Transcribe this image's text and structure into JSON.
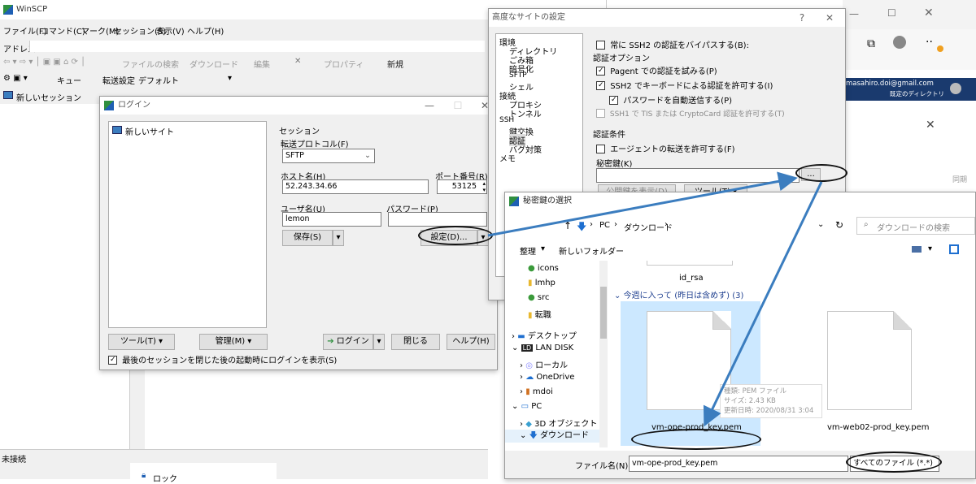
{
  "winscp": {
    "title": "WinSCP",
    "menu": [
      "ファイル(F)",
      "コマンド(C)",
      "マーク(M)",
      "セッション(S)",
      "表示(V)",
      "ヘルプ(H)"
    ],
    "address_label": "アドレス",
    "toolbar_items": [
      "ファイルの検索",
      "ダウンロード",
      "編集",
      "プロパティ",
      "新規"
    ],
    "queue_label": "キュー",
    "transfer_label": "転送設定",
    "transfer_value": "デフォルト",
    "new_session": "新しいセッション",
    "status": "未接続",
    "lock_label": "ロック"
  },
  "login": {
    "title": "ログイン",
    "tree_item": "新しいサイト",
    "session_group": "セッション",
    "protocol_label": "転送プロトコル(F)",
    "protocol_value": "SFTP",
    "host_label": "ホスト名(H)",
    "host_value": "52.243.34.66",
    "port_label": "ポート番号(R)",
    "port_value": "53125",
    "user_label": "ユーザ名(U)",
    "user_value": "lemon",
    "password_label": "パスワード(P)",
    "password_value": "",
    "save_button": "保存(S)",
    "settings_button": "設定(D)...",
    "tools_button": "ツール(T)",
    "manage_button": "管理(M)",
    "login_button": "ログイン",
    "close_button": "閉じる",
    "help_button": "ヘルプ(H)",
    "show_login_check": "最後のセッションを閉じた後の起動時にログインを表示(S)"
  },
  "advanced": {
    "title": "高度なサイトの設定",
    "tree": [
      "環境",
      "ディレクトリ",
      "ごみ箱",
      "暗号化",
      "SFTP",
      "シェル",
      "接続",
      "プロキシ",
      "トンネル",
      "SSH",
      "鍵交換",
      "認証",
      "バグ対策",
      "メモ"
    ],
    "bypass_check": "常に SSH2 の認証をバイパスする(B):",
    "auth_options": "認証オプション",
    "pageant_check": "Pagent での認証を試みる(P)",
    "keyboard_check": "SSH2 でキーボードによる認証を許可する(I)",
    "auto_password_check": "パスワードを自動送信する(P)",
    "tis_check": "SSH1 で TIS または CryptoCard 認証を許可する(T)",
    "auth_params": "認証条件",
    "agent_forward_check": "エージェントの転送を許可する(F)",
    "private_key_label": "秘密鍵(K)",
    "browse_button": "...",
    "show_public_key": "公開鍵を表示(D)",
    "tools_button": "ツール(T)"
  },
  "browser": {
    "account_email": "masahiro.doi@gmail.com",
    "account_dir": "既定のディレクトリ",
    "side_label": "同期"
  },
  "filedialog": {
    "title": "秘密鍵の選択",
    "breadcrumb": [
      "PC",
      "ダウンロード"
    ],
    "search_placeholder": "ダウンロードの検索",
    "organize": "整理",
    "new_folder": "新しいフォルダー",
    "nav": [
      "icons",
      "lmhp",
      "src",
      "転職",
      "デスクトップ",
      "LAN DISK",
      "ローカル",
      "OneDrive",
      "mdoi",
      "PC",
      "3D オブジェクト",
      "ダウンロード"
    ],
    "top_file": "id_rsa",
    "group_header": "今週に入って (昨日は含めず) (3)",
    "files": [
      "vm-ope-prod_key.pem",
      "vm-web02-prod_key.pem"
    ],
    "tooltip": [
      "種類: PEM ファイル",
      "サイズ: 2.43 KB",
      "更新日時: 2020/08/31 3:04"
    ],
    "filename_label": "ファイル名(N):",
    "filename_value": "vm-ope-prod_key.pem",
    "filetype_value": "すべてのファイル (*.*)"
  },
  "colors": {
    "arrow": "#3b7dbf",
    "selection": "#cce8ff",
    "accent": "#0a64d6"
  }
}
